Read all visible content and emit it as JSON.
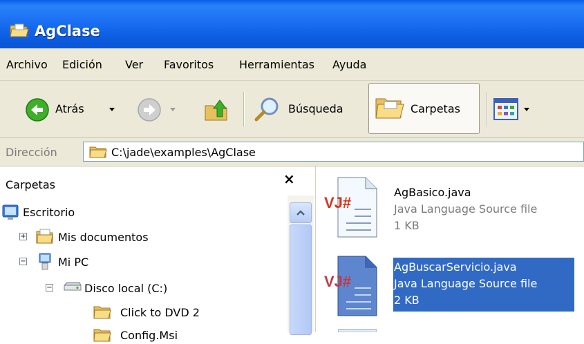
{
  "window": {
    "title": "AgClase",
    "icon": "open-folder-icon"
  },
  "menubar": {
    "items": [
      "Archivo",
      "Edición",
      "Ver",
      "Favoritos",
      "Herramientas",
      "Ayuda"
    ]
  },
  "toolbar": {
    "back_label": "Atrás",
    "search_label": "Búsqueda",
    "folders_label": "Carpetas",
    "back_icon": "back-arrow-icon",
    "forward_icon": "forward-arrow-icon",
    "up_icon": "folder-up-icon",
    "search_icon": "magnifier-icon",
    "folders_icon": "folders-icon",
    "views_icon": "views-icon"
  },
  "address": {
    "label": "Dirección",
    "path": "C:\\jade\\examples\\AgClase"
  },
  "folder_pane": {
    "title": "Carpetas",
    "close": "×",
    "tree": [
      {
        "label": "Escritorio",
        "icon": "desktop-icon"
      },
      {
        "label": "Mis documentos",
        "icon": "my-documents-icon",
        "expander": "+"
      },
      {
        "label": "Mi PC",
        "icon": "my-computer-icon",
        "expander": "−"
      },
      {
        "label": "Disco local (C:)",
        "icon": "local-disk-icon",
        "expander": "−"
      },
      {
        "label": "Click to DVD 2",
        "icon": "folder-icon"
      },
      {
        "label": "Config.Msi",
        "icon": "folder-icon"
      }
    ]
  },
  "files": [
    {
      "name": "AgBasico.java",
      "type": "Java Language Source file",
      "size": "1 KB",
      "selected": false,
      "icon": "vj-sharp-file-icon"
    },
    {
      "name": "AgBuscarServicio.java",
      "type": "Java Language Source file",
      "size": "2 KB",
      "selected": true,
      "icon": "vj-sharp-file-icon"
    }
  ],
  "colors": {
    "titlebar": "#0a5ee8",
    "chrome": "#ece9d8",
    "selection": "#316ac5"
  }
}
